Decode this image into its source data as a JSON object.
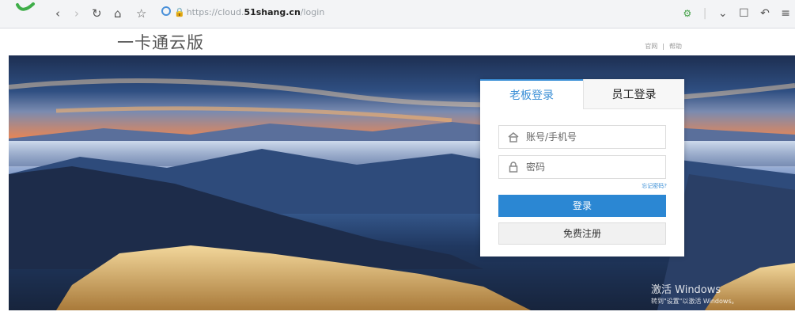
{
  "browser": {
    "url_scheme": "https://",
    "url_domain_prefix": "cloud.",
    "url_domain": "51shang.cn",
    "url_path": "/login"
  },
  "header": {
    "title": "一卡通云版",
    "links": [
      "官网",
      "|",
      "帮助"
    ]
  },
  "login": {
    "tabs": [
      {
        "label": "老板登录",
        "active": true
      },
      {
        "label": "员工登录",
        "active": false
      }
    ],
    "username_placeholder": "账号/手机号",
    "password_placeholder": "密码",
    "forgot_label": "忘记密码?",
    "login_button": "登录",
    "register_button": "免费注册"
  },
  "watermark": {
    "line1": "激活 Windows",
    "line2": "转到\"设置\"以激活 Windows。"
  },
  "colors": {
    "accent": "#2b87d3",
    "tab_active": "#3b8fd6"
  }
}
